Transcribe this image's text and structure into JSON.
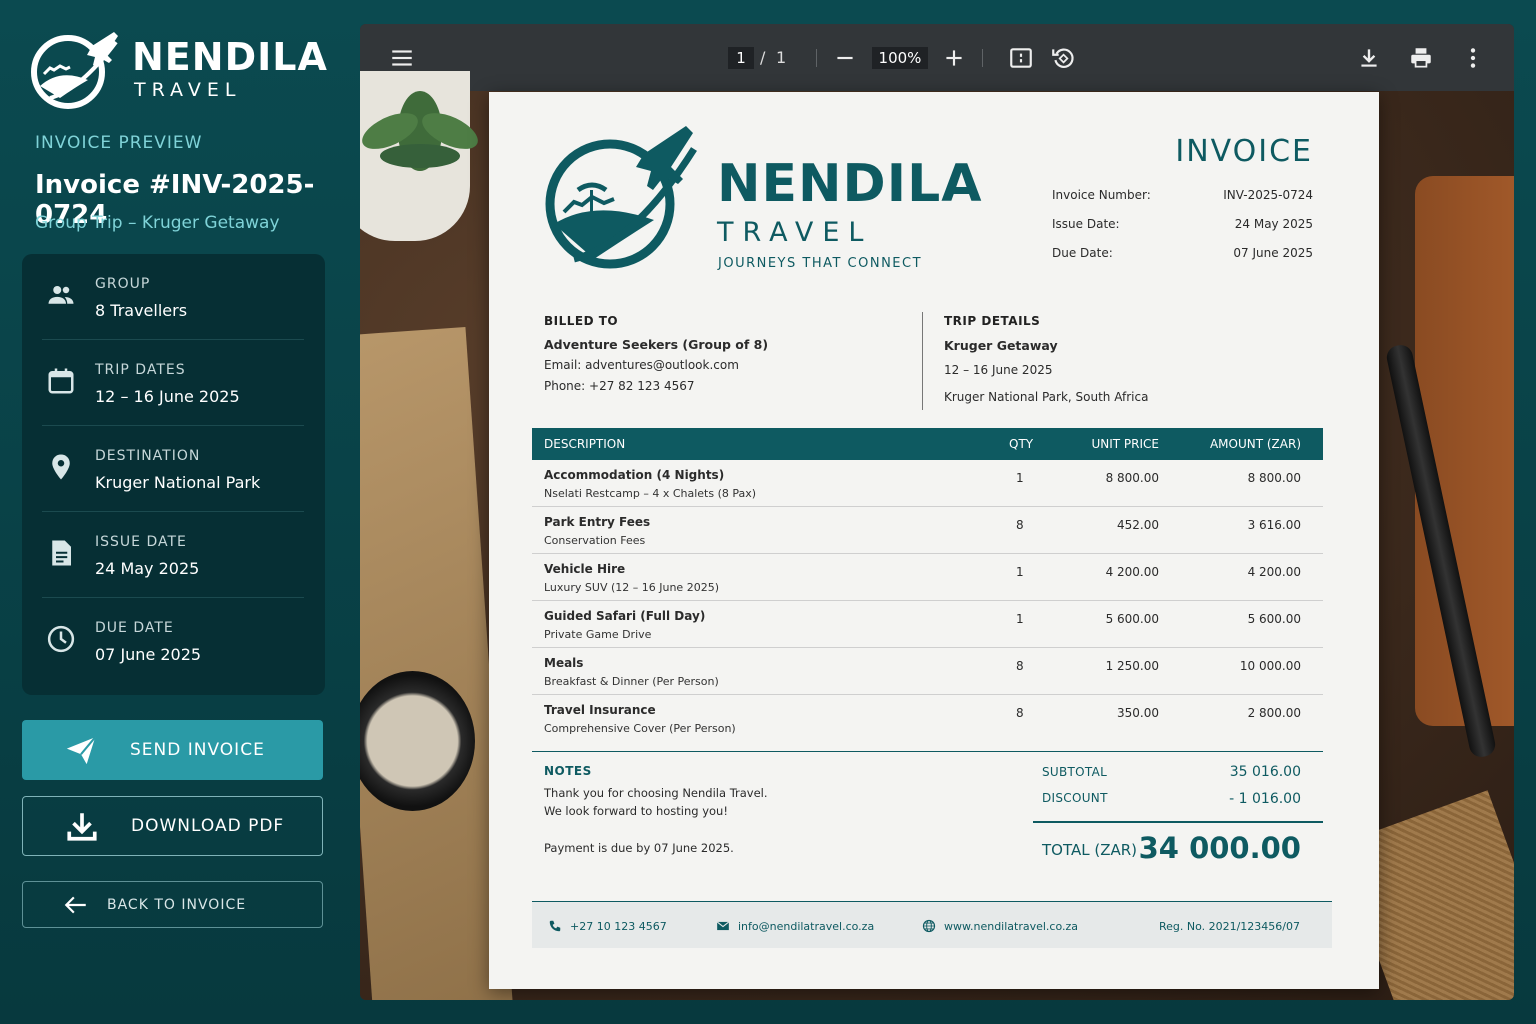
{
  "sidebar": {
    "brand_name": "NENDILA",
    "brand_sub": "TRAVEL",
    "preview_label": "INVOICE PREVIEW",
    "invoice_title": "Invoice #INV-2025-0724",
    "trip_name": "Group Trip – Kruger Getaway",
    "info": [
      {
        "label": "GROUP",
        "value": "8 Travellers",
        "icon": "group-icon"
      },
      {
        "label": "TRIP DATES",
        "value": "12 – 16 June 2025",
        "icon": "calendar-icon"
      },
      {
        "label": "DESTINATION",
        "value": "Kruger National Park",
        "icon": "location-pin-icon"
      },
      {
        "label": "ISSUE DATE",
        "value": "24 May 2025",
        "icon": "document-icon"
      },
      {
        "label": "DUE DATE",
        "value": "07 June 2025",
        "icon": "clock-icon"
      }
    ],
    "buttons": {
      "send": "SEND INVOICE",
      "download": "DOWNLOAD PDF",
      "back": "BACK TO INVOICE"
    }
  },
  "viewer": {
    "page_current": "1",
    "page_separator": "/",
    "page_total": "1",
    "zoom": "100%"
  },
  "invoice": {
    "brand_name": "NENDILA",
    "brand_sub": "TRAVEL",
    "tagline": "JOURNEYS THAT CONNECT",
    "title": "INVOICE",
    "meta": [
      {
        "key": "Invoice Number:",
        "value": "INV-2025-0724"
      },
      {
        "key": "Issue Date:",
        "value": "24 May 2025"
      },
      {
        "key": "Due Date:",
        "value": "07 June 2025"
      }
    ],
    "billed_to": {
      "heading": "BILLED TO",
      "name": "Adventure Seekers (Group of 8)",
      "email": "Email:  adventures@outlook.com",
      "phone": "Phone:  +27 82 123 4567"
    },
    "trip_details": {
      "heading": "TRIP DETAILS",
      "name": "Kruger Getaway",
      "dates": "12 – 16 June 2025",
      "location": "Kruger National Park, South Africa"
    },
    "table": {
      "headers": [
        "DESCRIPTION",
        "QTY",
        "UNIT PRICE",
        "AMOUNT (ZAR)"
      ],
      "rows": [
        {
          "title": "Accommodation (4 Nights)",
          "sub": "Nselati Restcamp – 4 x Chalets (8 Pax)",
          "qty": "1",
          "unit": "8 800.00",
          "amount": "8 800.00"
        },
        {
          "title": "Park Entry Fees",
          "sub": "Conservation Fees",
          "qty": "8",
          "unit": "452.00",
          "amount": "3 616.00"
        },
        {
          "title": "Vehicle Hire",
          "sub": "Luxury SUV (12 – 16 June 2025)",
          "qty": "1",
          "unit": "4 200.00",
          "amount": "4 200.00"
        },
        {
          "title": "Guided Safari (Full Day)",
          "sub": "Private Game Drive",
          "qty": "1",
          "unit": "5 600.00",
          "amount": "5 600.00"
        },
        {
          "title": "Meals",
          "sub": "Breakfast & Dinner (Per Person)",
          "qty": "8",
          "unit": "1 250.00",
          "amount": "10 000.00"
        },
        {
          "title": "Travel Insurance",
          "sub": "Comprehensive Cover (Per Person)",
          "qty": "8",
          "unit": "350.00",
          "amount": "2 800.00"
        }
      ]
    },
    "notes": {
      "heading": "NOTES",
      "line1": "Thank you for choosing Nendila Travel.",
      "line2": "We look forward to hosting you!",
      "payment": "Payment is due by 07 June 2025."
    },
    "totals": {
      "subtotal_label": "SUBTOTAL",
      "subtotal_value": "35 016.00",
      "discount_label": "DISCOUNT",
      "discount_value": "- 1 016.00",
      "total_label": "TOTAL (ZAR)",
      "total_value": "34 000.00"
    },
    "footer": {
      "phone": "+27 10 123 4567",
      "email": "info@nendilatravel.co.za",
      "web": "www.nendilatravel.co.za",
      "reg": "Reg. No. 2021/123456/07"
    }
  },
  "colors": {
    "brand_teal": "#0e5a61",
    "sidebar_bg": "#0b4a50",
    "accent": "#2a9aa6",
    "toolbar": "#323639"
  }
}
